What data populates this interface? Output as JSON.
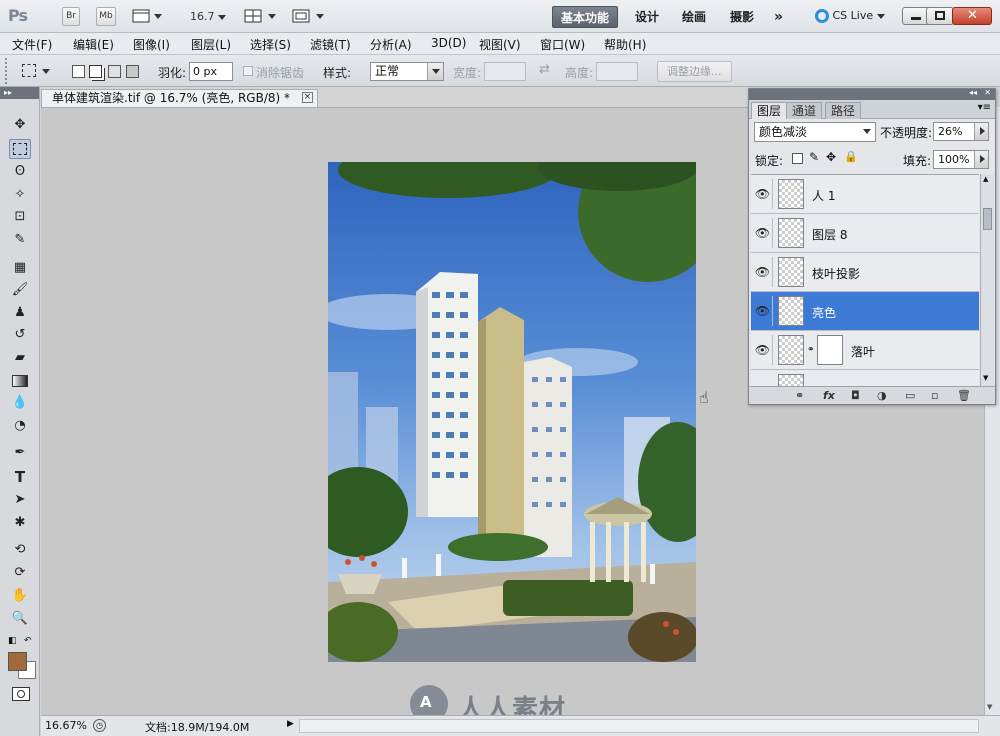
{
  "app": {
    "logo": "Ps",
    "bridge_label": "Br",
    "minibridge_label": "Mb",
    "zoom_value": "16.7",
    "workspaces": [
      "基本功能",
      "设计",
      "绘画",
      "摄影"
    ],
    "more": "»",
    "cs_live": "CS Live"
  },
  "menu": [
    "文件(F)",
    "编辑(E)",
    "图像(I)",
    "图层(L)",
    "选择(S)",
    "滤镜(T)",
    "分析(A)",
    "3D(D)",
    "视图(V)",
    "窗口(W)",
    "帮助(H)"
  ],
  "options": {
    "feather_label": "羽化:",
    "feather_value": "0 px",
    "antialias_label": "消除锯齿",
    "style_label": "样式:",
    "style_value": "正常",
    "width_label": "宽度:",
    "height_label": "高度:",
    "refine_label": "调整边缘..."
  },
  "document": {
    "tab_title": "单体建筑渲染.tif @ 16.7% (亮色, RGB/8) *",
    "close": "×"
  },
  "status": {
    "zoom": "16.67%",
    "doc_info": "文档:18.9M/194.0M"
  },
  "layers_panel": {
    "tabs": [
      "图层",
      "通道",
      "路径"
    ],
    "blend_mode": "颜色减淡",
    "opacity_label": "不透明度:",
    "opacity_value": "26%",
    "lock_label": "锁定:",
    "fill_label": "填充:",
    "fill_value": "100%",
    "layers": [
      {
        "name": "人 1",
        "selected": false
      },
      {
        "name": "图层 8",
        "selected": false
      },
      {
        "name": "枝叶投影",
        "selected": false
      },
      {
        "name": "亮色",
        "selected": true
      },
      {
        "name": "落叶",
        "selected": false
      }
    ],
    "footer": [
      "⚭",
      "fx",
      "◘",
      "◑",
      "▭",
      "▫",
      "🗑"
    ]
  },
  "watermark": "人人素材",
  "colors": {
    "selected_layer": "#3d7ad6",
    "foreground_color": "#a06a3a",
    "background_color": "#ffffff"
  }
}
